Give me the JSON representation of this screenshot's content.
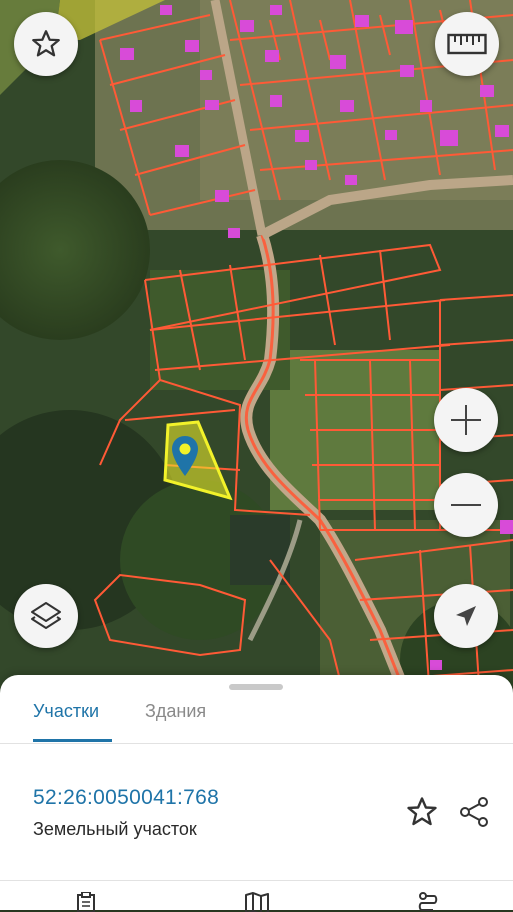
{
  "map": {
    "type": "satellite-cadastral",
    "boundary_color": "#ff5a36",
    "selected_parcel_color": "#f2f22a",
    "building_color": "#d84bd8",
    "pin_color": "#1f74a8"
  },
  "controls": {
    "favorites_icon": "star-icon",
    "ruler_icon": "ruler-icon",
    "zoom_in_icon": "plus-icon",
    "zoom_out_icon": "minus-icon",
    "layers_icon": "layers-icon",
    "location_icon": "navigation-arrow-icon"
  },
  "sheet": {
    "tabs": [
      {
        "label": "Участки",
        "active": true
      },
      {
        "label": "Здания",
        "active": false
      }
    ],
    "parcel": {
      "number": "52:26:0050041:768",
      "type": "Земельный участок"
    },
    "accent": "#1f74a8"
  },
  "bottom_nav": {
    "icons": [
      "clipboard-icon",
      "map-icon",
      "route-icon"
    ]
  }
}
